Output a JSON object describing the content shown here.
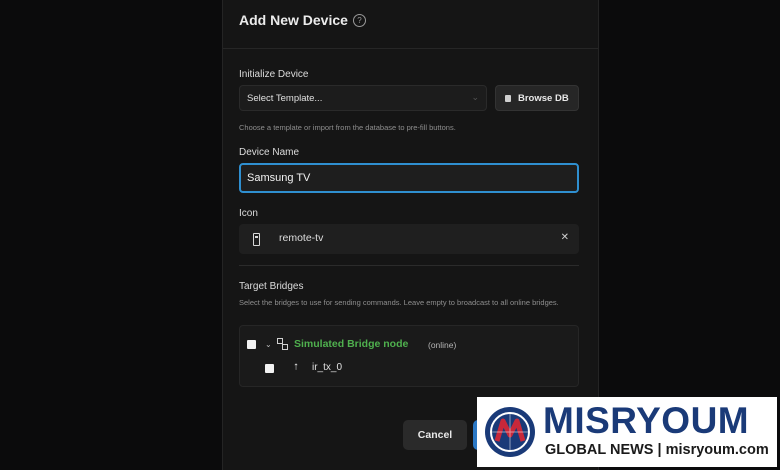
{
  "dialog": {
    "title": "Add New Device",
    "help_icon": "question-circle-icon"
  },
  "initialize": {
    "label": "Initialize Device",
    "select_value": "Select Template...",
    "browse_label": "Browse DB",
    "browse_icon": "database-icon",
    "hint": "Choose a template or import from the database to pre-fill buttons."
  },
  "device_name": {
    "label": "Device Name",
    "value": "Samsung TV"
  },
  "icon": {
    "label": "Icon",
    "value": "remote-tv",
    "icon_name": "remote-icon",
    "clear_icon": "close-icon"
  },
  "bridges": {
    "label": "Target Bridges",
    "hint": "Select the bridges to use for sending commands. Leave empty to broadcast to all online bridges.",
    "node_name": "Simulated Bridge node",
    "node_status": "(online)",
    "node_icon": "network-icon",
    "transmitter": "ir_tx_0",
    "transmitter_icon": "upload-icon"
  },
  "footer": {
    "cancel_label": "Cancel"
  },
  "watermark": {
    "name": "MISRYOUM",
    "subtitle": "GLOBAL NEWS | misryoum.com"
  },
  "colors": {
    "accent": "#2f8fd0",
    "online": "#4fb04e",
    "brand": "#1a3a78"
  }
}
